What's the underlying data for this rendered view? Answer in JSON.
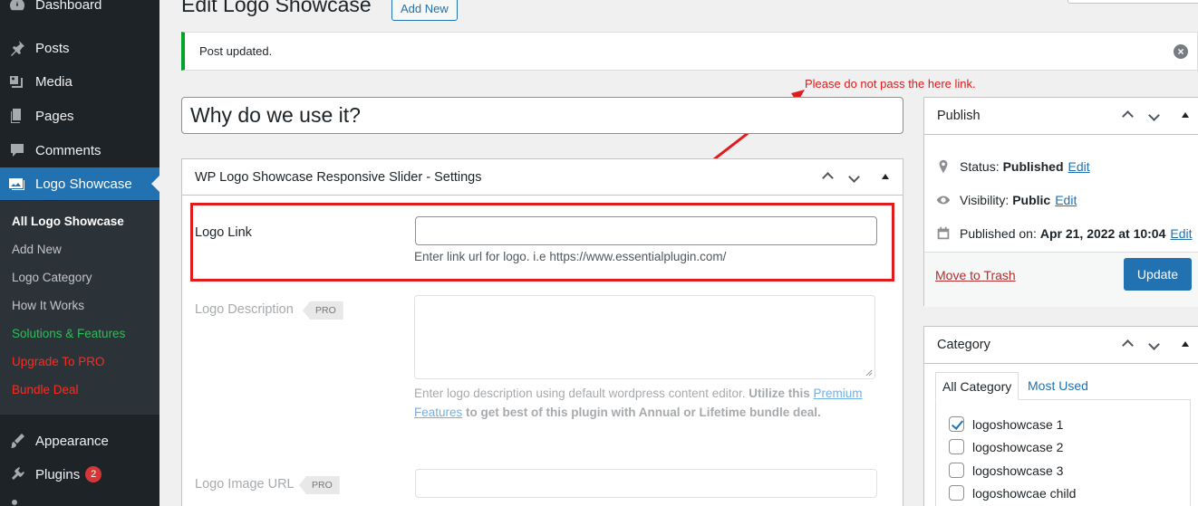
{
  "sidebar": {
    "menu": [
      {
        "label": "Dashboard",
        "icon": "dashboard-icon"
      },
      {
        "label": "Posts",
        "icon": "pin-icon"
      },
      {
        "label": "Media",
        "icon": "media-icon"
      },
      {
        "label": "Pages",
        "icon": "pages-icon"
      },
      {
        "label": "Comments",
        "icon": "comment-icon"
      },
      {
        "label": "Logo Showcase",
        "icon": "images-icon"
      },
      {
        "label": "Appearance",
        "icon": "paintbrush-icon"
      },
      {
        "label": "Plugins",
        "icon": "plugin-icon",
        "badge": "2"
      }
    ],
    "submenu": [
      {
        "label": "All Logo Showcase"
      },
      {
        "label": "Add New"
      },
      {
        "label": "Logo Category"
      },
      {
        "label": "How It Works"
      },
      {
        "label": "Solutions & Features"
      },
      {
        "label": "Upgrade To PRO"
      },
      {
        "label": "Bundle Deal"
      }
    ]
  },
  "header": {
    "title": "Edit Logo Showcase",
    "add_new": "Add New"
  },
  "notice": {
    "text": "Post updated.",
    "dismiss": "×"
  },
  "post": {
    "title_value": "Why do we use it?"
  },
  "settings_box": {
    "title": "WP Logo Showcase Responsive Slider - Settings",
    "logo_link": {
      "label": "Logo Link",
      "value": "",
      "help": "Enter link url for logo. i.e https://www.essentialplugin.com/"
    },
    "logo_description": {
      "label": "Logo Description",
      "badge": "PRO",
      "help_start": "Enter logo description using default wordpress content editor.",
      "help_bold": "Utilize this",
      "help_link": "Premium Features",
      "help_end": "to get best of this plugin with Annual or Lifetime bundle deal."
    },
    "logo_image_url": {
      "label": "Logo Image URL",
      "badge": "PRO"
    }
  },
  "annotation": {
    "text": "Please do not pass the here link.",
    "color": "#e01b1b"
  },
  "publish_box": {
    "title": "Publish",
    "status_label": "Status:",
    "status_value": "Published",
    "status_edit": "Edit",
    "visibility_label": "Visibility:",
    "visibility_value": "Public",
    "visibility_edit": "Edit",
    "published_label": "Published on:",
    "published_value": "Apr 21, 2022 at 10:04",
    "published_edit": "Edit",
    "trash": "Move to Trash",
    "update": "Update"
  },
  "category_box": {
    "title": "Category",
    "tabs": [
      "All Category",
      "Most Used"
    ],
    "items": [
      {
        "label": "logoshowcase 1",
        "checked": true
      },
      {
        "label": "logoshowcase 2",
        "checked": false
      },
      {
        "label": "logoshowcase 3",
        "checked": false
      },
      {
        "label": "logoshowcae child",
        "checked": false
      }
    ]
  }
}
